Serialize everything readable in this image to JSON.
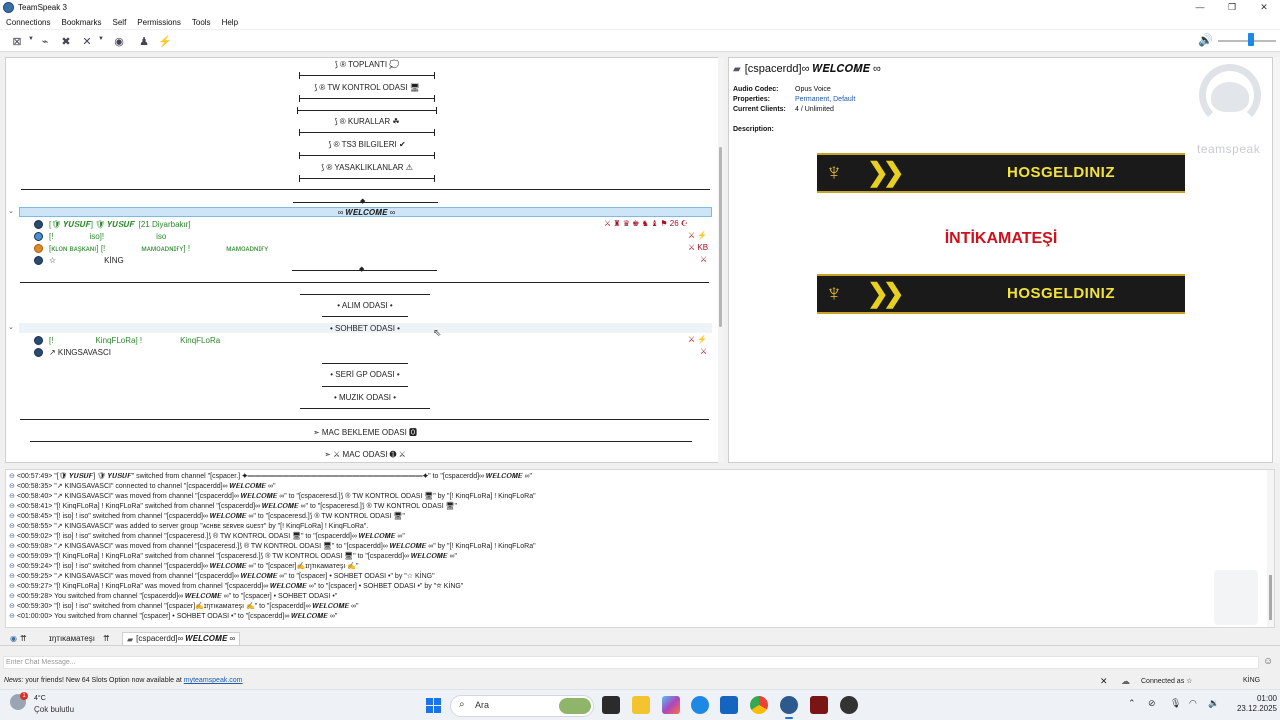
{
  "window": {
    "title": "TeamSpeak 3",
    "minimize": "—",
    "restore": "❐",
    "close": "✕"
  },
  "menu": [
    "Connections",
    "Bookmarks",
    "Self",
    "Permissions",
    "Tools",
    "Help"
  ],
  "toolbar": {
    "icons": [
      "connect-icon",
      "disconnect-icon",
      "away-icon",
      "mute-microphone-icon",
      "mute-speakers-icon",
      "subscribe-icon",
      "contacts-icon",
      "bookmark-icon"
    ],
    "volume_icon": "speaker-icon"
  },
  "tree": {
    "channels": [
      "⟆ ® TOPLANTI 💭",
      "⟆ ® TW KONTROL ODASI 🖥",
      "⟆ ® KURALLAR ☘",
      "⟆ ® TS3 BILGILERI ✔",
      "⟆ ® YASAKLIKLANLAR ⚠"
    ],
    "welcome_channel": "∞ 𝑾𝑬𝑳𝑪𝑶𝑴𝑬 ∞",
    "welcome_clients": [
      {
        "name": "[🛡 𝒀𝑼𝑺𝑼𝑭] 🛡 𝒀𝑼𝑺𝑼𝑭",
        "suffix": "[21 Diyarbakır]",
        "icons": "⚔ ♜ ♛ ♚ ♞ ♝ ⚑ 26 ☪"
      },
      {
        "name": "[!",
        "mid": "iso]!",
        "suffix": "iso",
        "icons": "⚔ ⚡"
      },
      {
        "name": "[ᴋʟᴏɴ ʙᴀşᴋᴀɴı] [!",
        "mid": "ᴍᴀᴍᴏᴀᴅɴɪғʏ] !",
        "suffix": "ᴍᴀᴍᴏᴀᴅɴɪғʏ",
        "icons": "⚔ KB"
      },
      {
        "name": "☆",
        "mid": "KİNG",
        "suffix": "",
        "icons": "⚔"
      }
    ],
    "alim_channel": "• ALIM ODASI •",
    "sohbet_channel": "• SOHBET ODASI •",
    "sohbet_clients": [
      {
        "name": "[!",
        "mid": "KinqFLoRa] !",
        "suffix": "KinqFLoRa",
        "icons": "⚔ ⚡"
      },
      {
        "name": "↗ KINGSAVASCI",
        "mid": "",
        "suffix": "",
        "icons": "⚔"
      }
    ],
    "seri_channel": "• SERİ GP ODASI •",
    "muzik_channel": "• MUZIK ODASI •",
    "mac_bekleme": "➣ MAC BEKLEME ODASI 🅾",
    "mac_odasi": "➣ ⚔ MAC ODASI ➊ ⚔"
  },
  "info": {
    "title": "[cspacerdd]∞ 𝑾𝑬𝑳𝑪𝑶𝑴𝑬 ∞",
    "audio_codec_label": "Audio Codec:",
    "audio_codec": "Opus Voice",
    "properties_label": "Properties:",
    "properties": "Permanent, Default",
    "clients_label": "Current Clients:",
    "clients": "4 / Unlimited",
    "description_label": "Description:",
    "banner_text": "HOSGELDINIZ",
    "red_text": "İNTİKAMATEŞİ",
    "logo_text": "teamspeak"
  },
  "log": [
    "<00:57:49> \"[🛡 𝒀𝑼𝑺𝑼𝑭] 🛡 𝒀𝑼𝑺𝑼𝑭\" switched from channel \"[cspacer.] ✦━━━━━━━━━━━━━━━━━━━━━━━━━✦\" to \"[cspacerdd]∞ 𝑾𝑬𝑳𝑪𝑶𝑴𝑬 ∞\"",
    "<00:58:35> \"↗ KINGSAVASCI\" connected to channel \"[cspacerdd]∞ 𝑾𝑬𝑳𝑪𝑶𝑴𝑬 ∞\"",
    "<00:58:40> \"↗ KINGSAVASCI\" was moved from channel \"[cspacerdd]∞ 𝑾𝑬𝑳𝑪𝑶𝑴𝑬 ∞\" to \"[cspaceresd.]⟆ ® TW KONTROL ODASI 🖥\" by \"[!                   KinqFLoRa] !                     KinqFLoRa\"",
    "<00:58:41> \"[!           KinqFLoRa] !           KinqFLoRa\" switched from channel \"[cspacerdd]∞ 𝑾𝑬𝑳𝑪𝑶𝑴𝑬 ∞\" to \"[cspaceresd.]⟆ ® TW KONTROL ODASI 🖥\"",
    "<00:58:45> \"[!           iso] !           iso\" switched from channel \"[cspacerdd]∞ 𝑾𝑬𝑳𝑪𝑶𝑴𝑬 ∞\" to \"[cspaceresd.]⟆ ® TW KONTROL ODASI 🖥\"",
    "<00:58:55> \"↗ KINGSAVASCI\" was added to server group \"ᴀᴄʜʙᴇ sᴇʀᴠᴇʀ ɢᴜᴇsᴛ\" by \"[!              KinqFLoRa] !           KinqFLoRa\".",
    "<00:59:02> \"[!           iso] !           iso\" switched from channel \"[cspaceresd.]⟆ ® TW KONTROL ODASI 🖥\" to \"[cspacerdd]∞ 𝑾𝑬𝑳𝑪𝑶𝑴𝑬 ∞\"",
    "<00:59:08> \"↗ KINGSAVASCI\" was moved from channel \"[cspaceresd.]⟆ ® TW KONTROL ODASI 🖥\" to \"[cspacerdd]∞ 𝑾𝑬𝑳𝑪𝑶𝑴𝑬 ∞\" by \"[!              KinqFLoRa] !                  KinqFLoRa\"",
    "<00:59:09> \"[!           KinqFLoRa] !           KinqFLoRa\" switched from channel \"[cspaceresd.]⟆ ® TW KONTROL ODASI 🖥\" to \"[cspacerdd]∞ 𝑾𝑬𝑳𝑪𝑶𝑴𝑬 ∞\"",
    "<00:59:24> \"[!           iso] !           iso\" switched from channel \"[cspacerdd]∞ 𝑾𝑬𝑳𝑪𝑶𝑴𝑬 ∞\" to \"[cspacer]✍ɪŋтıĸaмaтeşı ✍\"",
    "<00:59:25> \"↗ KINGSAVASCI\" was moved from channel \"[cspacerdd]∞ 𝑾𝑬𝑳𝑪𝑶𝑴𝑬 ∞\" to \"[cspacer] • SOHBET ODASI •\" by \"☆              KİNG\"",
    "<00:59:27> \"[!           KinqFLoRa] !           KinqFLoRa\" was moved from channel \"[cspacerdd]∞ 𝑾𝑬𝑳𝑪𝑶𝑴𝑬 ∞\" to \"[cspacer] • SOHBET ODASI •\" by \"☆              KİNG\"",
    "<00:59:28> You switched from channel \"[cspacerdd]∞ 𝑾𝑬𝑳𝑪𝑶𝑴𝑬 ∞\" to \"[cspacer] • SOHBET ODASI •\"",
    "<00:59:30> \"[!           iso] !           iso\" switched from channel \"[cspacer]✍ɪŋтıĸaмaтeşı ✍\" to \"[cspacerdd]∞ 𝑾𝑬𝑳𝑪𝑶𝑴𝑬 ∞\"",
    "<01:00:00> You switched from channel \"[cspacer] • SOHBET ODASI •\" to \"[cspacerdd]∞ 𝑾𝑬𝑳𝑪𝑶𝑴𝑬 ∞\""
  ],
  "tabs": {
    "server_icon_label": "⇈",
    "intikam": "ɪŋтıĸaмaтeşı",
    "sep": "⇈",
    "active": "[cspacerdd]∞ 𝑾𝑬𝑳𝑪𝑶𝑴𝑬 ∞"
  },
  "chat": {
    "placeholder": "Enter Chat Message..."
  },
  "status": {
    "news_prefix": "News:",
    "news_text": " your friends! New 64 Slots Option now available at ",
    "news_link": "myteamspeak.com",
    "connected": "Connected as ☆",
    "nick": "KİNG"
  },
  "taskbar": {
    "badge": "1",
    "temp": "4°C",
    "weather": "Çok bulutlu",
    "search": "Ara",
    "time": "01:00",
    "date": "23.12.2025"
  },
  "colors": {
    "accent": "#1e88e5",
    "selected_row": "#cde5f7",
    "banner_gold": "#f2e23a",
    "red_title": "#d0101c"
  }
}
